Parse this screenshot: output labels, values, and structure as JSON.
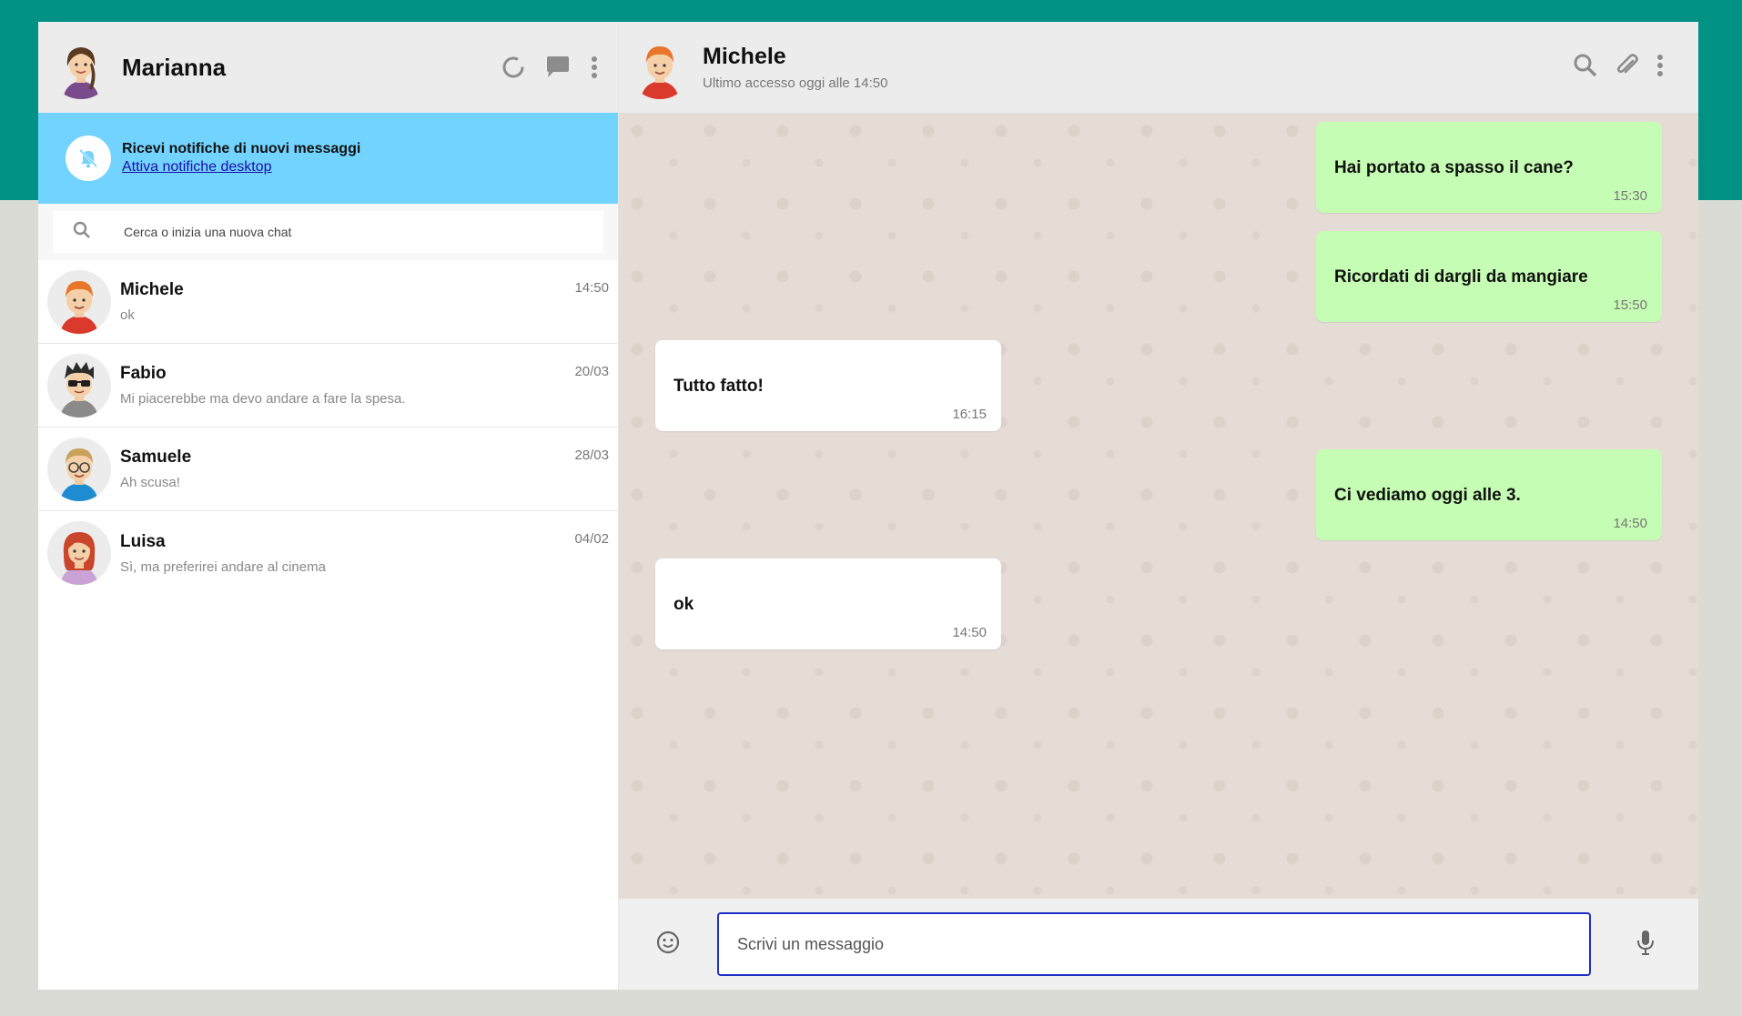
{
  "user": {
    "name": "Marianna"
  },
  "notification": {
    "title": "Ricevi notifiche di nuovi messaggi",
    "link": "Attiva notifiche desktop"
  },
  "search": {
    "placeholder": "Cerca o inizia una nuova chat"
  },
  "chats": [
    {
      "name": "Michele",
      "last": "ok",
      "time": "14:50"
    },
    {
      "name": "Fabio",
      "last": "Mi piacerebbe ma devo andare a fare la spesa.",
      "time": "20/03"
    },
    {
      "name": "Samuele",
      "last": "Ah scusa!",
      "time": "28/03"
    },
    {
      "name": "Luisa",
      "last": "Sì, ma preferirei andare al cinema",
      "time": "04/02"
    }
  ],
  "active_chat": {
    "name": "Michele",
    "status": "Ultimo accesso oggi alle 14:50"
  },
  "messages": [
    {
      "text": "Hai portato a spasso il cane?",
      "time": "15:30",
      "direction": "out"
    },
    {
      "text": "Ricordati di dargli da mangiare",
      "time": "15:50",
      "direction": "out"
    },
    {
      "text": "Tutto fatto!",
      "time": "16:15",
      "direction": "in"
    },
    {
      "text": "Ci vediamo oggi alle 3.",
      "time": "14:50",
      "direction": "out"
    },
    {
      "text": "ok",
      "time": "14:50",
      "direction": "in"
    }
  ],
  "composer": {
    "placeholder": "Scrivi un messaggio"
  },
  "colors": {
    "brand_band": "#029185",
    "notification_bg": "#72d4fe",
    "outgoing_bubble": "#c6fdb4",
    "incoming_bubble": "#ffffff",
    "chat_bg": "#e5ddd5"
  },
  "icons": {
    "sidebar_header": [
      "status-ring-icon",
      "new-chat-icon",
      "menu-dots-icon"
    ],
    "main_header": [
      "search-icon",
      "attach-icon",
      "menu-dots-icon"
    ],
    "composer": [
      "emoji-icon",
      "microphone-icon"
    ],
    "notification": "bell-muted-icon",
    "search": "search-icon"
  }
}
